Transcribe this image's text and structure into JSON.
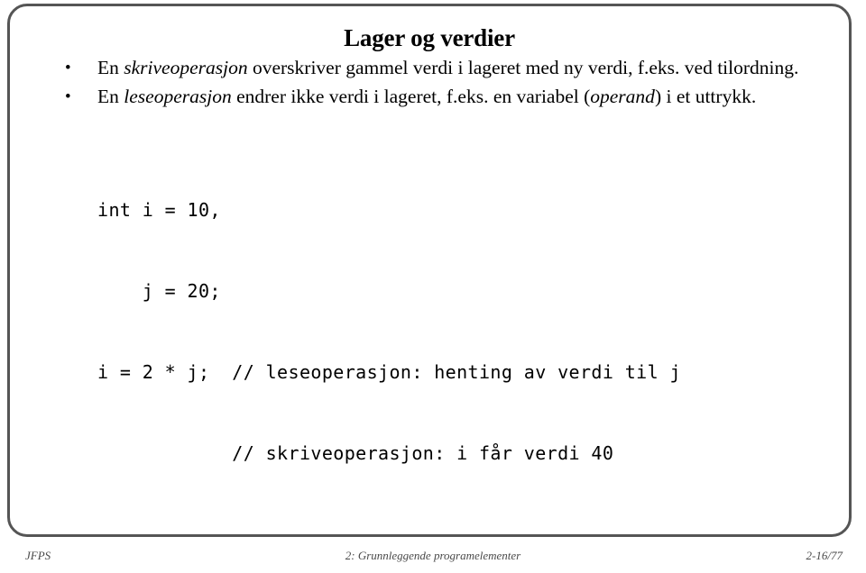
{
  "slide": {
    "title": "Lager og verdier",
    "bullets": [
      {
        "marker": "•",
        "segments": [
          {
            "text": "En ",
            "style": "normal"
          },
          {
            "text": "skriveoperasjon",
            "style": "italic"
          },
          {
            "text": " overskriver gammel verdi i lageret med ny verdi, f.eks. ved tilordning.",
            "style": "normal"
          }
        ],
        "plain": "En skriveoperasjon overskriver gammel verdi i lageret med ny verdi, f.eks. ved tilordning."
      },
      {
        "marker": "•",
        "segments": [
          {
            "text": "En ",
            "style": "normal"
          },
          {
            "text": "leseoperasjon",
            "style": "italic"
          },
          {
            "text": " endrer ikke verdi i lageret, f.eks. en variabel (",
            "style": "normal"
          },
          {
            "text": "operand",
            "style": "italic"
          },
          {
            "text": ") i et uttrykk.",
            "style": "normal"
          }
        ],
        "plain": "En leseoperasjon endrer ikke verdi i lageret, f.eks. en variabel (operand) i et uttrykk."
      }
    ],
    "code": {
      "lines": [
        "int i = 10,",
        "    j = 20;",
        "i = 2 * j;  // leseoperasjon: henting av verdi til j",
        "            // skriveoperasjon: i får verdi 40"
      ]
    }
  },
  "footer": {
    "left": "JFPS",
    "center": "2: Grunnleggende programelementer",
    "right": "2-16/77"
  },
  "colors": {
    "background": "#ffffff",
    "text": "#000000",
    "frame_border": "#555555",
    "footer_text": "#4a4a4a"
  }
}
